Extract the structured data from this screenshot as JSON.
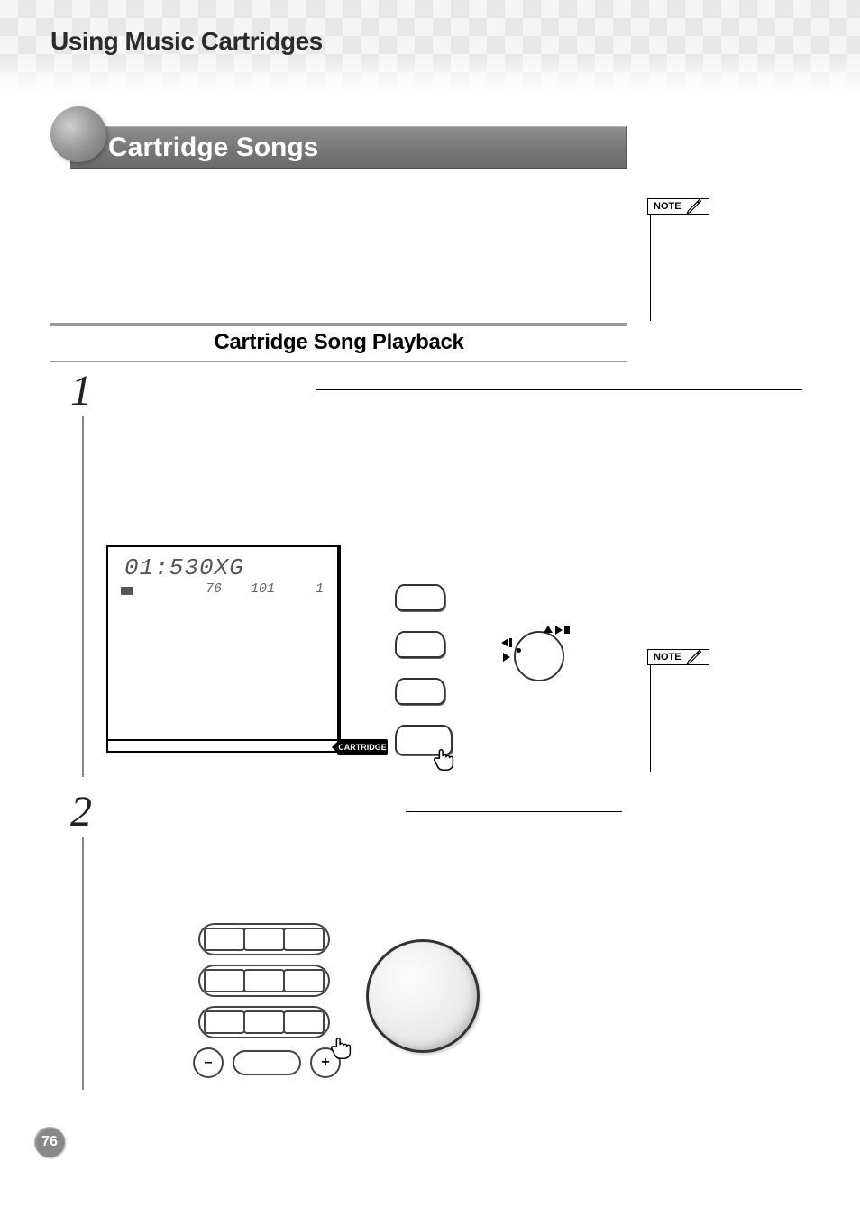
{
  "page": {
    "header": "Using Music Cartridges",
    "number": "76"
  },
  "section": {
    "title": "Cartridge Songs",
    "subhead": "Cartridge Song Playback"
  },
  "steps": {
    "one": "1",
    "two": "2"
  },
  "lcd": {
    "main": "01:530XG",
    "val1": "76",
    "val2": "101",
    "val3": "1"
  },
  "labels": {
    "cartridge_flag": "CARTRIDGE",
    "note": "NOTE",
    "minus": "–",
    "plus": "+"
  }
}
